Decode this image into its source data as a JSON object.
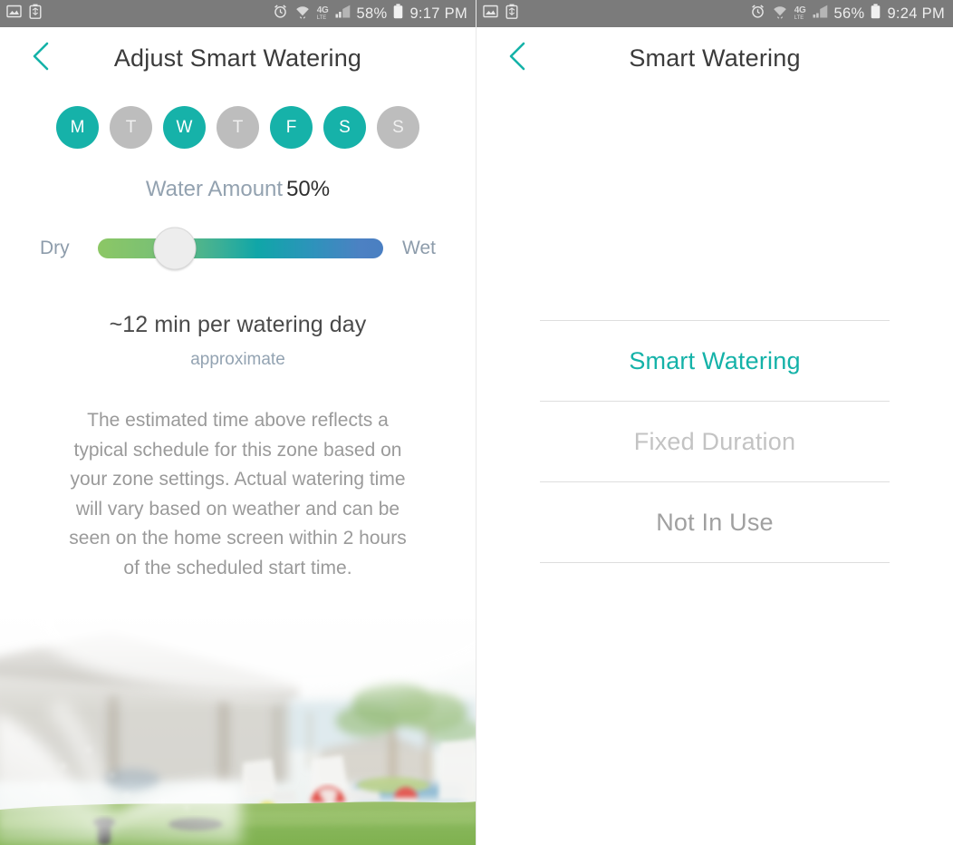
{
  "left_screen": {
    "statusbar": {
      "icons_left": [
        "picture-icon",
        "battery-recycle-icon"
      ],
      "alarm_icon": "alarm-icon",
      "wifi_icon": "wifi-icon",
      "network_label": "4G",
      "network_sub": "LTE",
      "signal_icon": "signal-bars-icon",
      "battery_percent": "58%",
      "battery_icon": "battery-icon",
      "time": "9:17 PM"
    },
    "header": {
      "back_icon": "chevron-left-icon",
      "title": "Adjust Smart Watering"
    },
    "days": [
      {
        "label": "M",
        "active": true
      },
      {
        "label": "T",
        "active": false
      },
      {
        "label": "W",
        "active": true
      },
      {
        "label": "T",
        "active": false
      },
      {
        "label": "F",
        "active": true
      },
      {
        "label": "S",
        "active": true
      },
      {
        "label": "S",
        "active": false
      }
    ],
    "water_amount": {
      "label": "Water Amount",
      "value": "50%",
      "percent": 50
    },
    "slider": {
      "left_label": "Dry",
      "right_label": "Wet",
      "thumb_percent": 27
    },
    "estimate": {
      "primary": "~12 min per watering day",
      "secondary": "approximate"
    },
    "body_copy": "The estimated time above reflects a typical schedule for this zone based on your zone settings. Actual watering time will vary based on weather and can be seen on the home screen within 2 hours of the scheduled start time.",
    "photo": {
      "alt": "sprinkler-watering-lawn-photo"
    }
  },
  "right_screen": {
    "statusbar": {
      "icons_left": [
        "picture-icon",
        "battery-recycle-icon"
      ],
      "alarm_icon": "alarm-icon",
      "wifi_icon": "wifi-icon",
      "network_label": "4G",
      "network_sub": "LTE",
      "signal_icon": "signal-bars-icon",
      "battery_percent": "56%",
      "battery_icon": "battery-icon",
      "time": "9:24 PM"
    },
    "header": {
      "back_icon": "chevron-left-icon",
      "title": "Smart Watering"
    },
    "modes": [
      {
        "label": "Smart Watering",
        "state": "selected"
      },
      {
        "label": "Fixed Duration",
        "state": "unselected"
      },
      {
        "label": "Not In Use",
        "state": "muted"
      }
    ]
  },
  "colors": {
    "accent_teal": "#16b2a9",
    "inactive_gray": "#bdbdbd",
    "statusbar_gray": "#7b7b7b",
    "muted_blue_gray": "#93a2b0",
    "slider_start": "#8cc765",
    "slider_mid": "#10a6a8",
    "slider_end": "#4a7fc2",
    "divider": "#dedede"
  }
}
